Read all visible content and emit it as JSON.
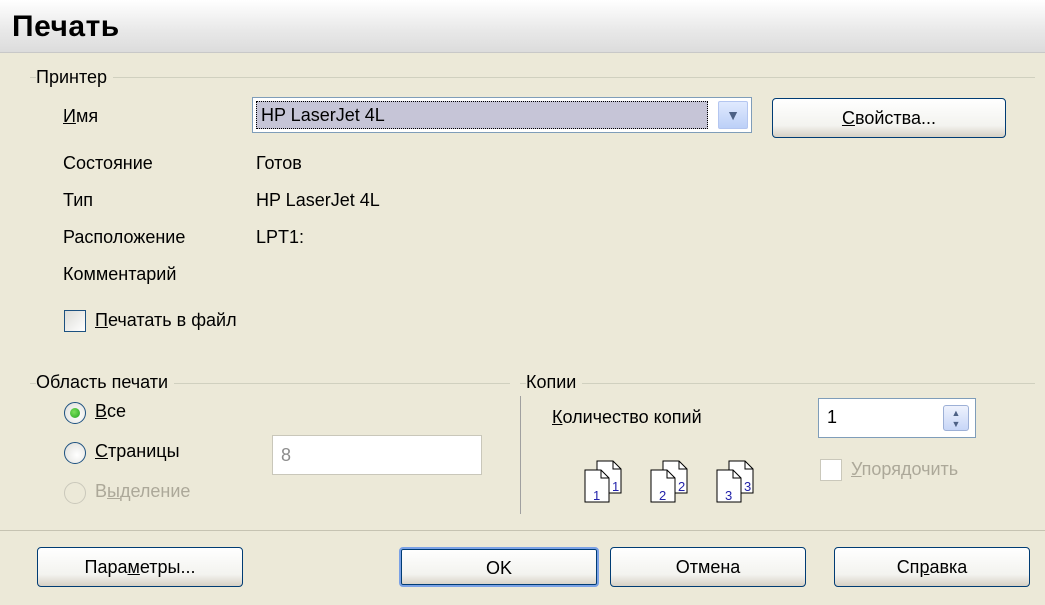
{
  "dialog": {
    "title": "Печать"
  },
  "printer_group": {
    "label": "Принтер",
    "name_label": "Имя",
    "name_value": "HP LaserJet 4L",
    "properties_button": "Свойства...",
    "status_label": "Состояние",
    "status_value": "Готов",
    "type_label": "Тип",
    "type_value": "HP LaserJet 4L",
    "location_label": "Расположение",
    "location_value": "LPT1:",
    "comment_label": "Комментарий",
    "comment_value": "",
    "print_to_file_label": "Печатать в файл",
    "print_to_file_checked": false
  },
  "range_group": {
    "label": "Область печати",
    "all_label": "Все",
    "pages_label": "Страницы",
    "pages_value": "8",
    "selection_label": "Выделение",
    "selected": "all"
  },
  "copies_group": {
    "label": "Копии",
    "count_label": "Количество копий",
    "count_value": "1",
    "collate_label": "Упорядочить",
    "collate_checked": false,
    "page_icons": [
      {
        "front": "1",
        "back": "1"
      },
      {
        "front": "2",
        "back": "2"
      },
      {
        "front": "3",
        "back": "3"
      }
    ]
  },
  "buttons": {
    "options": "Параметры...",
    "ok": "OK",
    "cancel": "Отмена",
    "help": "Справка"
  },
  "icons": {
    "close": "close-icon",
    "dropdown": "chevron-down-icon",
    "spinner": "spinner-updown-icon"
  },
  "colors": {
    "window_bg": "#ece9d8",
    "selection_bg": "#c6c5d7",
    "close_red": "#e2543b"
  }
}
